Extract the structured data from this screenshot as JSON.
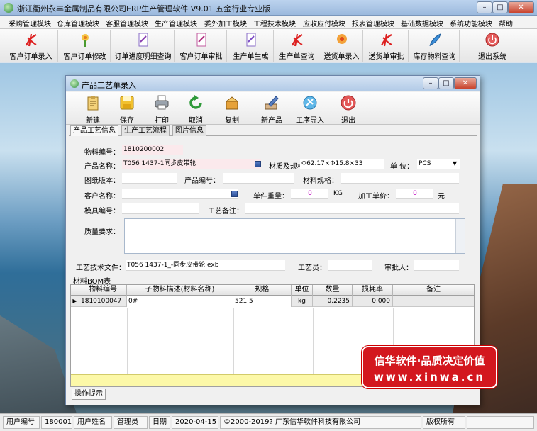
{
  "app": {
    "title": "浙江衢州永丰金属制品有限公司ERP生产管理软件  V9.01 五金行业专业版",
    "caption_buttons": [
      "–",
      "□",
      "✕"
    ]
  },
  "menu": [
    "采购管理模块",
    "仓库管理模块",
    "客服管理模块",
    "生产管理模块",
    "委外加工模块",
    "工程技术模块",
    "应收应付模块",
    "报表管理模块",
    "基础数据模块",
    "系统功能模块",
    "帮助"
  ],
  "toolbar": [
    {
      "label": "客户订单录入",
      "icon": "pdf-icon"
    },
    {
      "label": "客户订单修改",
      "icon": "flower-icon"
    },
    {
      "label": "订单进度明细查询",
      "icon": "document-icon"
    },
    {
      "label": "客户订单审批",
      "icon": "document-icon"
    },
    {
      "label": "生产单生成",
      "icon": "document-icon"
    },
    {
      "label": "生产单查询",
      "icon": "pdf-icon"
    },
    {
      "label": "送货单录入",
      "icon": "flower-icon"
    },
    {
      "label": "送货单审批",
      "icon": "pdf-icon"
    },
    {
      "label": "库存物料查询",
      "icon": "feather-icon"
    },
    {
      "label": "退出系统",
      "icon": "power-icon"
    }
  ],
  "child": {
    "title": "产品工艺单录入",
    "toolbar": [
      "新建",
      "保存",
      "打印",
      "取消",
      "复制",
      "新产品",
      "工序导入",
      "退出"
    ],
    "tabs": [
      "产品工艺信息",
      "生产工艺流程",
      "图片信息"
    ],
    "form": {
      "material_no_label": "物料编号：",
      "material_no": "1810200002",
      "product_name_label": "产品名称：",
      "product_name": "T056 1437-1同步皮带轮",
      "material_spec_label": "材质及规格：",
      "material_spec": "Φ62.17×Φ15.8×33",
      "unit_label": "单 位：",
      "unit": "PCS",
      "drawing_ver_label": "图纸版本：",
      "drawing_ver": "",
      "product_code_label": "产品编号：",
      "product_code": "",
      "mat_spec2_label": "材料规格：",
      "mat_spec2": "",
      "customer_label": "客户名称：",
      "customer": "",
      "unit_weight_label": "单件重量：",
      "unit_weight": "0",
      "unit_weight_unit": "KG",
      "unit_price_label": "加工单价：",
      "unit_price": "0",
      "unit_price_unit": "元",
      "mold_no_label": "模具编号：",
      "mold_no": "",
      "process_note_label": "工艺备注：",
      "process_note": "",
      "quality_label": "质量要求：",
      "quality": "",
      "tech_file_label": "工艺技术文件：",
      "tech_file": "T056 1437-1_-同步皮带轮.exb",
      "craftsman_label": "工艺员：",
      "craftsman": "",
      "approver_label": "审批人：",
      "approver": ""
    },
    "bom": {
      "caption": "材料BOM表",
      "headers": [
        "物料编号",
        "子物料描述(材料名称)",
        "规格",
        "单位",
        "数量",
        "损耗率",
        "备注"
      ],
      "rows": [
        {
          "code": "1810100047",
          "desc": "0#",
          "spec": "521.5",
          "unit": "kg",
          "qty": "0.2235",
          "loss": "0.000",
          "note": ""
        }
      ]
    },
    "hint_tab": "操作提示"
  },
  "promo": {
    "line1": "信华软件·品质决定价值",
    "line2": "www.xinwa.cn"
  },
  "status": {
    "user_no_label": "用户编号",
    "user_no": "180001",
    "user_name_label": "用户姓名",
    "user_name": "管理员",
    "date_label": "日期",
    "date": "2020-04-15",
    "copyright": "©2000-2019?  广东信华软件科技有限公司",
    "rights": "版权所有"
  }
}
